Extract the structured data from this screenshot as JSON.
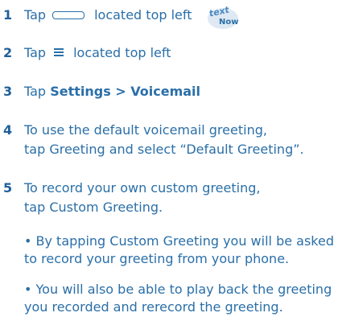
{
  "steps": [
    {
      "num": "1",
      "pre": "Tap",
      "post": "located top left"
    },
    {
      "num": "2",
      "pre": "Tap",
      "post": "located top left"
    },
    {
      "num": "3",
      "pre": "Tap",
      "bold1": "Settings",
      "sep": " > ",
      "bold2": "Voicemail"
    },
    {
      "num": "4",
      "line1": "To use the default voicemail greeting,",
      "line2": "tap Greeting and select “Default Greeting”."
    },
    {
      "num": "5",
      "line1": "To record your own custom greeting,",
      "line2": "tap Custom Greeting."
    }
  ],
  "bullets": [
    {
      "line1": "• By tapping Custom Greeting you will be asked",
      "line2": "to record your greeting from your phone."
    },
    {
      "line1": "• You will also be able to play back the greeting",
      "line2": "you recorded and rerecord the greeting."
    }
  ],
  "logo": {
    "text_top": "text",
    "text_bottom": "Now"
  },
  "icons": [
    "rounded-rect-icon",
    "hamburger-menu-icon",
    "textnow-logo-icon"
  ],
  "colors": {
    "text": "#2a6fa8",
    "number": "#1f5f9a"
  }
}
